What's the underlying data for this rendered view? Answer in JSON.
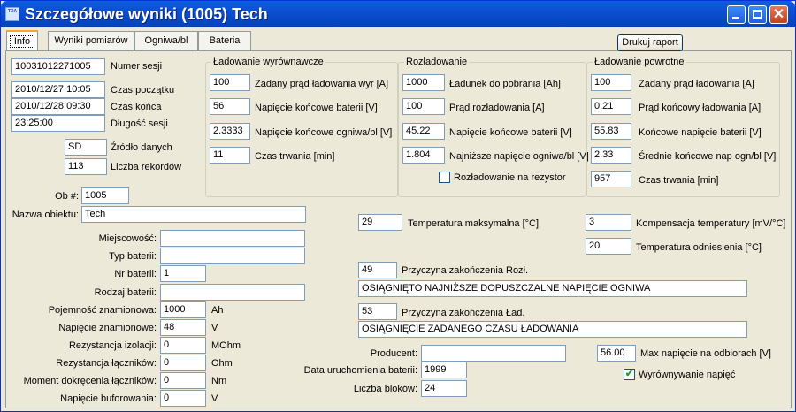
{
  "window": {
    "title": "Szczegółowe wyniki  (1005) Tech",
    "icon_text": "TDA"
  },
  "tabs": [
    "Info",
    "Wyniki pomiarów",
    "Ogniwa/bl",
    "Bateria"
  ],
  "print_button": "Drukuj raport",
  "session": {
    "number_value": "10031012271005",
    "number_label": "Numer sesji",
    "start_value": "2010/12/27 10:05",
    "start_label": "Czas początku",
    "end_value": "2010/12/28 09:30",
    "end_label": "Czas końca",
    "duration_value": "23:25:00",
    "duration_label": "Długość sesji",
    "source_value": "SD",
    "source_label": "Źródło danych",
    "records_value": "113",
    "records_label": "Liczba rekordów"
  },
  "equalizing": {
    "title": "Ładowanie wyrównawcze",
    "rows": [
      {
        "value": "100",
        "label": "Zadany prąd ładowania wyr [A]"
      },
      {
        "value": "56",
        "label": "Napięcie końcowe baterii [V]"
      },
      {
        "value": "2.3333",
        "label": "Napięcie końcowe ogniwa/bl [V]"
      },
      {
        "value": "11",
        "label": "Czas trwania [min]"
      }
    ]
  },
  "discharge": {
    "title": "Rozładowanie",
    "rows": [
      {
        "value": "1000",
        "label": "Ładunek do pobrania [Ah]"
      },
      {
        "value": "100",
        "label": "Prąd rozładowania [A]"
      },
      {
        "value": "45.22",
        "label": "Napięcie końcowe baterii [V]"
      },
      {
        "value": "1.804",
        "label": "Najniższe napięcie ogniwa/bl [V]"
      }
    ],
    "resistor_label": "Rozładowanie na rezystor",
    "resistor_checked": false
  },
  "recharge": {
    "title": "Ładowanie powrotne",
    "rows": [
      {
        "value": "100",
        "label": "Zadany prąd ładowania [A]"
      },
      {
        "value": "0.21",
        "label": "Prąd końcowy ładowania [A]"
      },
      {
        "value": "55.83",
        "label": "Końcowe napięcie baterii [V]"
      },
      {
        "value": "2.33",
        "label": "Średnie końcowe nap ogn/bl [V]"
      },
      {
        "value": "957",
        "label": "Czas trwania [min]"
      }
    ]
  },
  "object": {
    "id_label": "Ob #:",
    "id_value": "1005",
    "name_label": "Nazwa obiektu:",
    "name_value": "Tech"
  },
  "battery": {
    "rows": [
      {
        "label": "Miejscowość:",
        "value": "",
        "unit": ""
      },
      {
        "label": "Typ baterii:",
        "value": "",
        "unit": ""
      },
      {
        "label": "Nr baterii:",
        "value": "1",
        "unit": ""
      },
      {
        "label": "Rodzaj baterii:",
        "value": "",
        "unit": ""
      },
      {
        "label": "Pojemność znamionowa:",
        "value": "1000",
        "unit": "Ah"
      },
      {
        "label": "Napięcie znamionowe:",
        "value": "48",
        "unit": "V"
      },
      {
        "label": "Rezystancja izolacji:",
        "value": "0",
        "unit": "MOhm"
      },
      {
        "label": "Rezystancja łączników:",
        "value": "0",
        "unit": "Ohm"
      },
      {
        "label": "Moment dokręcenia łączników:",
        "value": "0",
        "unit": "Nm"
      },
      {
        "label": "Napięcie buforowania:",
        "value": "0",
        "unit": "V"
      }
    ]
  },
  "temperature": {
    "max_value": "29",
    "max_label": "Temperatura maksymalna [°C]",
    "comp_value": "3",
    "comp_label": "Kompensacja temperatury [mV/°C]",
    "ref_value": "20",
    "ref_label": "Temperatura odniesienia [°C]"
  },
  "reasons": {
    "discharge_code": "49",
    "discharge_label": "Przyczyna zakończenia Rozł.",
    "discharge_text": "OSIĄGNIĘTO NAJNIŻSZE DOPUSZCZALNE NAPIĘCIE OGNIWA",
    "charge_code": "53",
    "charge_label": "Przyczyna zakończenia Ład.",
    "charge_text": "OSIĄGNIĘCIE ZADANEGO CZASU ŁADOWANIA"
  },
  "producer": {
    "producer_label": "Producent:",
    "producer_value": "",
    "start_date_label": "Data uruchomienia baterii:",
    "start_date_value": "1999",
    "blocks_label": "Liczba bloków:",
    "blocks_value": "24"
  },
  "max_voltage": {
    "value": "56.00",
    "label": "Max napięcie na odbiorach [V]"
  },
  "balancing": {
    "label": "Wyrównywanie napięć",
    "checked": true
  }
}
